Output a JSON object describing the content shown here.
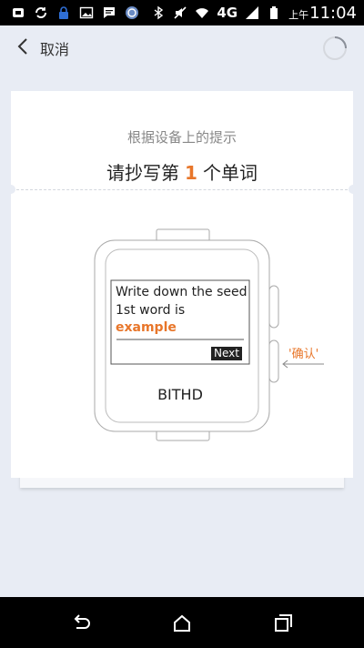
{
  "status_bar": {
    "network": "4G",
    "ampm": "上午",
    "time": "11:04",
    "icons": [
      "usb-icon",
      "sync-icon",
      "lock-icon",
      "image-icon",
      "message-icon",
      "app-icon",
      "bluetooth-icon",
      "mute-icon",
      "wifi-icon",
      "signal-icon",
      "battery-icon"
    ]
  },
  "header": {
    "cancel_label": "取消"
  },
  "card": {
    "hint": "根据设备上的提示",
    "title_prefix": "请抄写第",
    "title_number": "1",
    "title_suffix": "个单词"
  },
  "device": {
    "screen_line1": "Write down the seed",
    "screen_line2": "1st word is",
    "seed_word": "example",
    "next_label": "Next",
    "brand": "BITHD",
    "confirm_label": "'确认'"
  },
  "colors": {
    "accent": "#e8762a",
    "background": "#e8ecf4"
  },
  "nav_bar": {
    "buttons": [
      "back-nav-icon",
      "home-nav-icon",
      "recents-nav-icon"
    ]
  }
}
